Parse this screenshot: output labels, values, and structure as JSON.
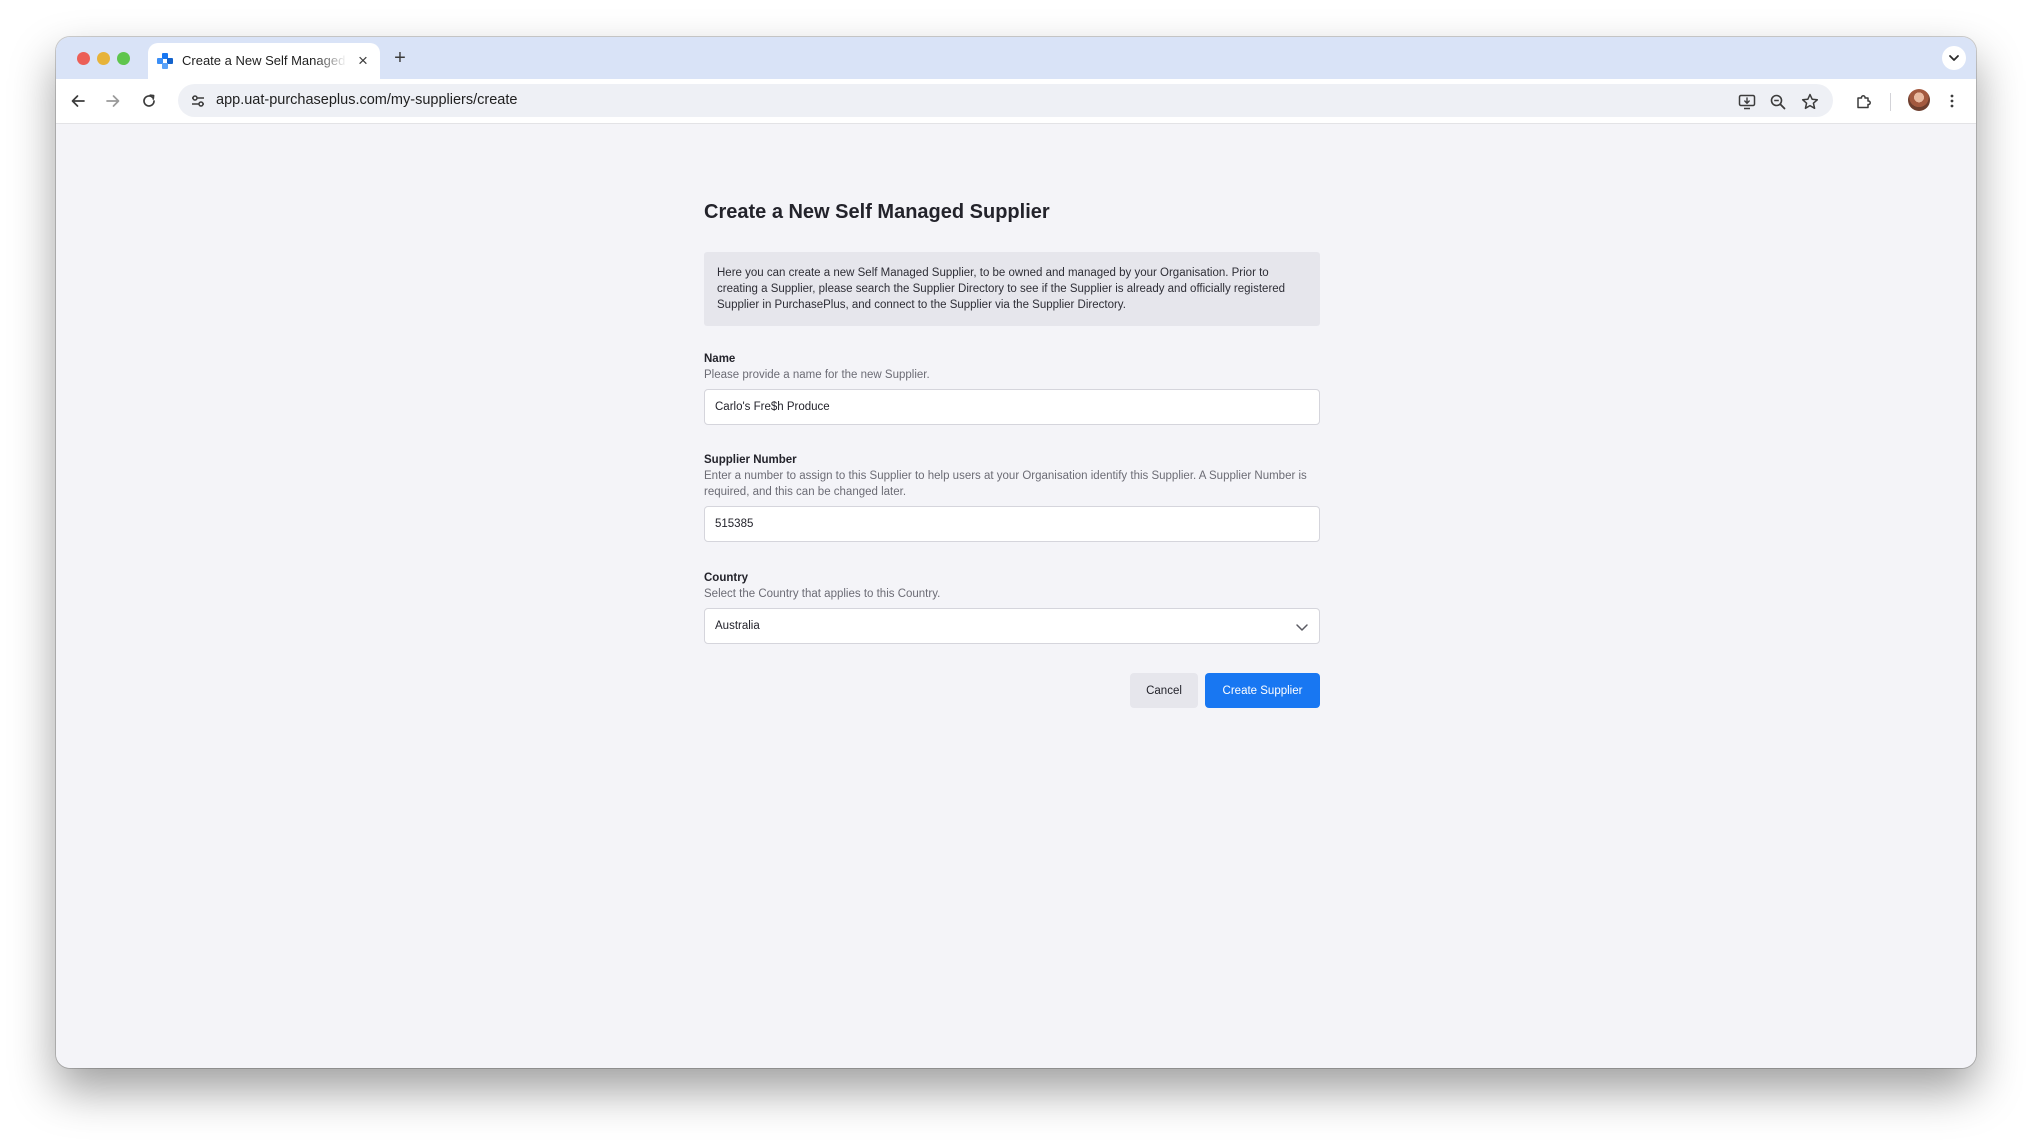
{
  "browser": {
    "tab_title": "Create a New Self Managed Supplier",
    "new_tab_label": "+",
    "close_label": "×",
    "url": "app.uat-purchaseplus.com/my-suppliers/create"
  },
  "page": {
    "title": "Create a New Self Managed Supplier",
    "intro": "Here you can create a new Self Managed Supplier, to be owned and managed by your Organisation. Prior to creating a Supplier, please search the Supplier Directory to see if the Supplier is already and officially registered Supplier in PurchasePlus, and connect to the Supplier via the Supplier Directory."
  },
  "form": {
    "name": {
      "label": "Name",
      "help": "Please provide a name for the new Supplier.",
      "value": "Carlo's Fre$h Produce"
    },
    "supplier_number": {
      "label": "Supplier Number",
      "help": "Enter a number to assign to this Supplier to help users at your Organisation identify this Supplier. A Supplier Number is required, and this can be changed later.",
      "value": "515385"
    },
    "country": {
      "label": "Country",
      "help": "Select the Country that applies to this Country.",
      "value": "Australia"
    },
    "cancel_label": "Cancel",
    "create_label": "Create Supplier"
  },
  "colors": {
    "primary": "#1877f2",
    "tab_strip": "#d9e3f7",
    "page_bg": "#f4f4f8"
  },
  "icons": [
    "back-icon",
    "forward-icon",
    "reload-icon",
    "site-settings-icon",
    "install-app-icon",
    "zoom-icon",
    "bookmark-star-icon",
    "extensions-icon",
    "more-menu-icon",
    "tab-search-icon",
    "chevron-down-icon"
  ]
}
